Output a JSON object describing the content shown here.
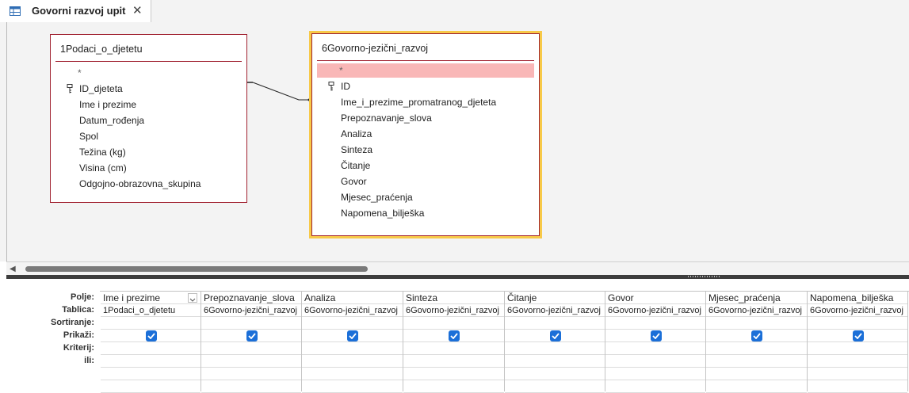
{
  "tab": {
    "title": "Govorni razvoj upit",
    "close": "✕"
  },
  "tables": [
    {
      "title": "1Podaci_o_djetetu",
      "fields": [
        "*",
        "ID_djeteta",
        "Ime i prezime",
        "Datum_rođenja",
        "Spol",
        "Težina (kg)",
        "Visina (cm)",
        "Odgojno-obrazovna_skupina"
      ]
    },
    {
      "title": "6Govorno-jezični_razvoj",
      "fields": [
        "*",
        "ID",
        "Ime_i_prezime_promatranog_djeteta",
        "Prepoznavanje_slova",
        "Analiza",
        "Sinteza",
        "Čitanje",
        "Govor",
        "Mjesec_praćenja",
        "Napomena_bilješka"
      ]
    }
  ],
  "grid": {
    "row_labels": [
      "Polje:",
      "Tablica:",
      "Sortiranje:",
      "Prikaži:",
      "Kriterij:",
      "ili:"
    ],
    "columns": [
      {
        "field": "Ime i prezime",
        "table": "1Podaci_o_djetetu",
        "show": true
      },
      {
        "field": "Prepoznavanje_slova",
        "table": "6Govorno-jezični_razvoj",
        "show": true
      },
      {
        "field": "Analiza",
        "table": "6Govorno-jezični_razvoj",
        "show": true
      },
      {
        "field": "Sinteza",
        "table": "6Govorno-jezični_razvoj",
        "show": true
      },
      {
        "field": "Čitanje",
        "table": "6Govorno-jezični_razvoj",
        "show": true
      },
      {
        "field": "Govor",
        "table": "6Govorno-jezični_razvoj",
        "show": true
      },
      {
        "field": "Mjesec_praćenja",
        "table": "6Govorno-jezični_razvoj",
        "show": true
      },
      {
        "field": "Napomena_bilješka",
        "table": "6Govorno-jezični_razvoj",
        "show": true
      }
    ]
  },
  "colors": {
    "accent": "#1b6fd8",
    "table_border": "#a0202f",
    "selection": "#f7c948",
    "highlight": "#f9b7b7"
  }
}
